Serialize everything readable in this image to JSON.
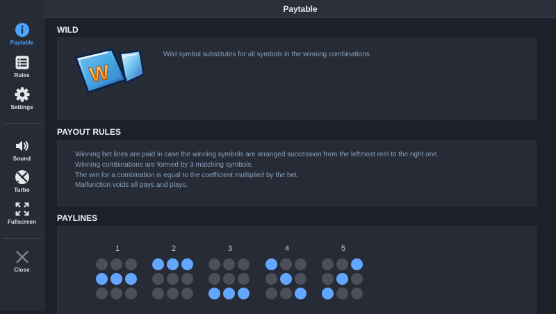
{
  "header": {
    "title": "Paytable"
  },
  "sidebar": {
    "items": [
      {
        "label": "Paytable",
        "icon": "info-icon",
        "active": true
      },
      {
        "label": "Rules",
        "icon": "list-icon"
      },
      {
        "label": "Settings",
        "icon": "gear-icon"
      },
      {
        "label": "Sound",
        "icon": "speaker-icon"
      },
      {
        "label": "Turbo",
        "icon": "turbo-icon"
      },
      {
        "label": "Fullscreen",
        "icon": "fullscreen-icon"
      },
      {
        "label": "Close",
        "icon": "close-icon"
      }
    ]
  },
  "wild": {
    "title": "WILD",
    "symbol_letter": "W",
    "description": "Wild symbol substitutes for all symbols in the winning combinations."
  },
  "payout_rules": {
    "title": "PAYOUT RULES",
    "lines": [
      "Winning bet lines are paid in case the winning symbols are arranged succession from the leftmost reel to the right one.",
      "Winning combinations are formed by 3 matching symbols.",
      "The win for a combination is equal to the coefficient multiplied by the bet.",
      "Malfunction voids all pays and plays."
    ]
  },
  "paylines": {
    "title": "PAYLINES",
    "lines": [
      {
        "number": "1",
        "pattern": [
          [
            0,
            0,
            0
          ],
          [
            1,
            1,
            1
          ],
          [
            0,
            0,
            0
          ]
        ]
      },
      {
        "number": "2",
        "pattern": [
          [
            1,
            1,
            1
          ],
          [
            0,
            0,
            0
          ],
          [
            0,
            0,
            0
          ]
        ]
      },
      {
        "number": "3",
        "pattern": [
          [
            0,
            0,
            0
          ],
          [
            0,
            0,
            0
          ],
          [
            1,
            1,
            1
          ]
        ]
      },
      {
        "number": "4",
        "pattern": [
          [
            1,
            0,
            0
          ],
          [
            0,
            1,
            0
          ],
          [
            0,
            0,
            1
          ]
        ]
      },
      {
        "number": "5",
        "pattern": [
          [
            0,
            0,
            1
          ],
          [
            0,
            1,
            0
          ],
          [
            1,
            0,
            0
          ]
        ]
      }
    ]
  },
  "colors": {
    "accent": "#4aa3ff",
    "dot_on": "#62a6ff",
    "dot_off": "#4a4f59"
  }
}
